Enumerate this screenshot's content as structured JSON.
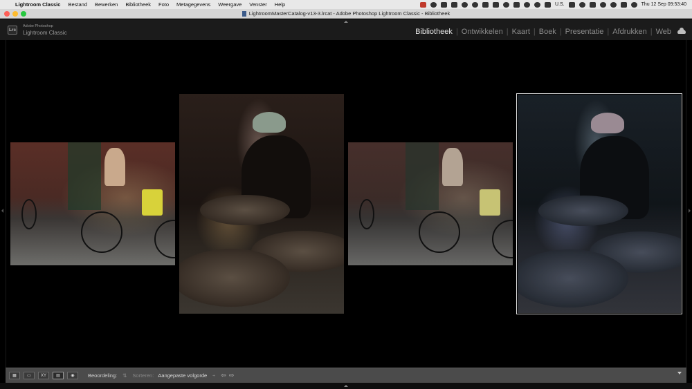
{
  "menubar": {
    "app_name": "Lightroom Classic",
    "items": [
      "Bestand",
      "Bewerken",
      "Bibliotheek",
      "Foto",
      "Metagegevens",
      "Weergave",
      "Venster",
      "Help"
    ],
    "input_source": "U.S.",
    "datetime": "Thu 12 Sep  09:53:40"
  },
  "titlebar": {
    "title": "LightroomMasterCatalog-v13-3.lrcat - Adobe Photoshop Lightroom Classic - Bibliotheek"
  },
  "header": {
    "logo": "Lrc",
    "brand_line1": "Adobe Photoshop",
    "brand_line2": "Lightroom Classic",
    "modules": [
      "Bibliotheek",
      "Ontwikkelen",
      "Kaart",
      "Boek",
      "Presentatie",
      "Afdrukken",
      "Web"
    ],
    "active_module": "Bibliotheek"
  },
  "survey": {
    "photos": [
      {
        "subject": "cyclist-street",
        "selected": false
      },
      {
        "subject": "woman-winnowing-rice",
        "selected": false
      },
      {
        "subject": "cyclist-street-muted",
        "selected": false
      },
      {
        "subject": "woman-winnowing-rice-cool",
        "selected": true
      }
    ]
  },
  "toolbar": {
    "rating_label": "Beoordeling:",
    "sort_label": "Sorteren:",
    "sort_value": "Aangepaste volgorde",
    "sort_caret": "÷"
  },
  "icons": {
    "apple": "apple-icon",
    "view_modes": [
      "grid-view-icon",
      "loupe-view-icon",
      "compare-view-icon",
      "survey-view-icon",
      "people-view-icon"
    ]
  }
}
